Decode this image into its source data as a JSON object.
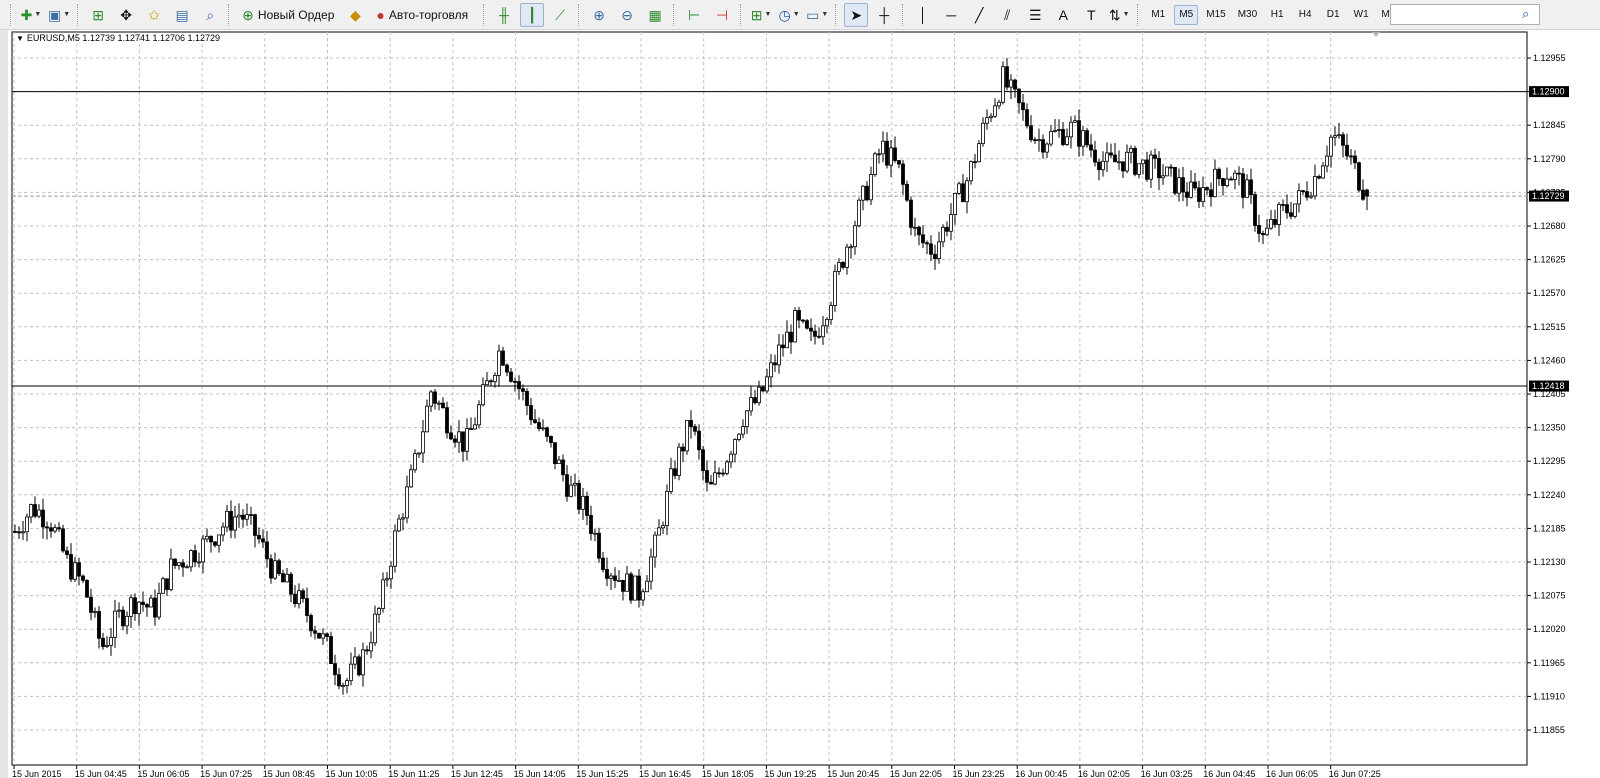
{
  "toolbar": {
    "new_order": "Новый Ордер",
    "auto_trading": "Авто-торговля",
    "timeframes": [
      "M1",
      "M5",
      "M15",
      "M30",
      "H1",
      "H4",
      "D1",
      "W1",
      "MN"
    ],
    "active_timeframe": "M5",
    "search_value": ""
  },
  "chart": {
    "symbol_info": "EURUSD,M5  1.12739 1.12741 1.12706 1.12729",
    "colors": {
      "background": "#ffffff",
      "grid": "#c0c0c0",
      "candle": "#000000",
      "bid_label_bg": "#000000",
      "label_fg": "#ffffff"
    }
  },
  "chart_data": {
    "type": "candlestick",
    "symbol": "EURUSD",
    "timeframe": "M5",
    "price_ticks": [
      "1.12955",
      "1.12900",
      "1.12845",
      "1.12790",
      "1.12735",
      "1.12680",
      "1.12625",
      "1.12570",
      "1.12515",
      "1.12460",
      "1.12405",
      "1.12350",
      "1.12295",
      "1.12240",
      "1.12185",
      "1.12130",
      "1.12075",
      "1.12020",
      "1.11965",
      "1.11910",
      "1.11855"
    ],
    "time_ticks": [
      "15 Jun 2015",
      "15 Jun 04:45",
      "15 Jun 06:05",
      "15 Jun 07:25",
      "15 Jun 08:45",
      "15 Jun 10:05",
      "15 Jun 11:25",
      "15 Jun 12:45",
      "15 Jun 14:05",
      "15 Jun 15:25",
      "15 Jun 16:45",
      "15 Jun 18:05",
      "15 Jun 19:25",
      "15 Jun 20:45",
      "15 Jun 22:05",
      "15 Jun 23:25",
      "16 Jun 00:45",
      "16 Jun 02:05",
      "16 Jun 03:25",
      "16 Jun 04:45",
      "16 Jun 06:05",
      "16 Jun 07:25"
    ],
    "ylim": [
      1.11855,
      1.12955
    ],
    "horizontal_lines": [
      1.129,
      1.12418
    ],
    "price_labels": [
      "1.12900",
      "1.12729",
      "1.12418"
    ],
    "bid": 1.12729,
    "last_bar": {
      "open": 1.12739,
      "high": 1.12741,
      "low": 1.12706,
      "close": 1.12729
    },
    "approx_closes": [
      1.1218,
      1.1222,
      1.122,
      1.1213,
      1.1209,
      1.1199,
      1.1204,
      1.1207,
      1.1205,
      1.1212,
      1.1214,
      1.1216,
      1.1219,
      1.1221,
      1.1217,
      1.1211,
      1.1208,
      1.1204,
      1.1199,
      1.1193,
      1.1197,
      1.1205,
      1.1218,
      1.1228,
      1.1241,
      1.1236,
      1.1232,
      1.124,
      1.1248,
      1.1242,
      1.1236,
      1.1231,
      1.1225,
      1.1221,
      1.1213,
      1.121,
      1.1208,
      1.1216,
      1.1228,
      1.1236,
      1.1224,
      1.123,
      1.1237,
      1.124,
      1.1247,
      1.1252,
      1.1249,
      1.1256,
      1.1265,
      1.1273,
      1.1281,
      1.1277,
      1.1266,
      1.1264,
      1.127,
      1.1276,
      1.1285,
      1.1292,
      1.1287,
      1.1282,
      1.1283,
      1.1284,
      1.1281,
      1.1278,
      1.1279,
      1.1278,
      1.1277,
      1.1275,
      1.1273,
      1.1275,
      1.1277,
      1.1274,
      1.1266,
      1.127,
      1.1272,
      1.1276,
      1.1283,
      1.1279,
      1.1273
    ]
  }
}
